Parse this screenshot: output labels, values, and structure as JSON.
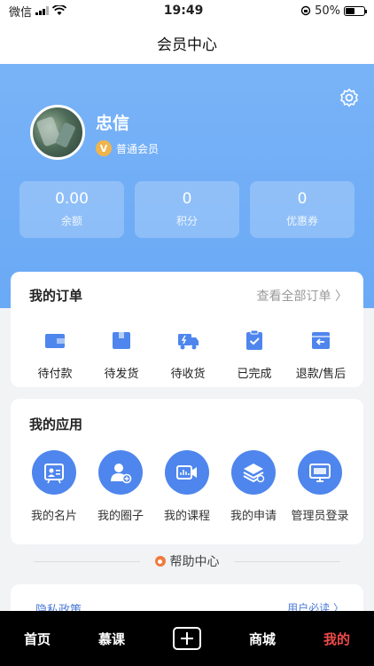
{
  "status": {
    "carrier": "微信",
    "time": "19:49",
    "battery": "50%",
    "battery_level": 0.5
  },
  "header": {
    "title": "会员中心"
  },
  "profile": {
    "name": "忠信",
    "member_level": "普通会员",
    "member_icon_text": "V"
  },
  "stats": [
    {
      "value": "0.00",
      "label": "余额"
    },
    {
      "value": "0",
      "label": "积分"
    },
    {
      "value": "0",
      "label": "优惠券"
    }
  ],
  "orders": {
    "title": "我的订单",
    "see_all": "查看全部订单 〉",
    "items": [
      {
        "label": "待付款",
        "icon": "wallet-icon"
      },
      {
        "label": "待发货",
        "icon": "box-icon"
      },
      {
        "label": "待收货",
        "icon": "truck-icon"
      },
      {
        "label": "已完成",
        "icon": "clipboard-check-icon"
      },
      {
        "label": "退款/售后",
        "icon": "refund-icon"
      }
    ]
  },
  "apps": {
    "title": "我的应用",
    "items": [
      {
        "label": "我的名片",
        "icon": "business-card-icon"
      },
      {
        "label": "我的圈子",
        "icon": "user-plus-icon"
      },
      {
        "label": "我的课程",
        "icon": "video-icon"
      },
      {
        "label": "我的申请",
        "icon": "layers-icon"
      },
      {
        "label": "管理员登录",
        "icon": "monitor-icon"
      }
    ]
  },
  "help": {
    "label": "帮助中心"
  },
  "footer_links": {
    "left": "隐私政策",
    "right": "用户必读 〉"
  },
  "tabs": [
    {
      "label": "首页"
    },
    {
      "label": "慕课"
    },
    {
      "label": ""
    },
    {
      "label": "商城"
    },
    {
      "label": "我的"
    }
  ],
  "colors": {
    "accent": "#4f86ed",
    "hero": "#79b3f7",
    "active_tab": "#f04b4b"
  }
}
